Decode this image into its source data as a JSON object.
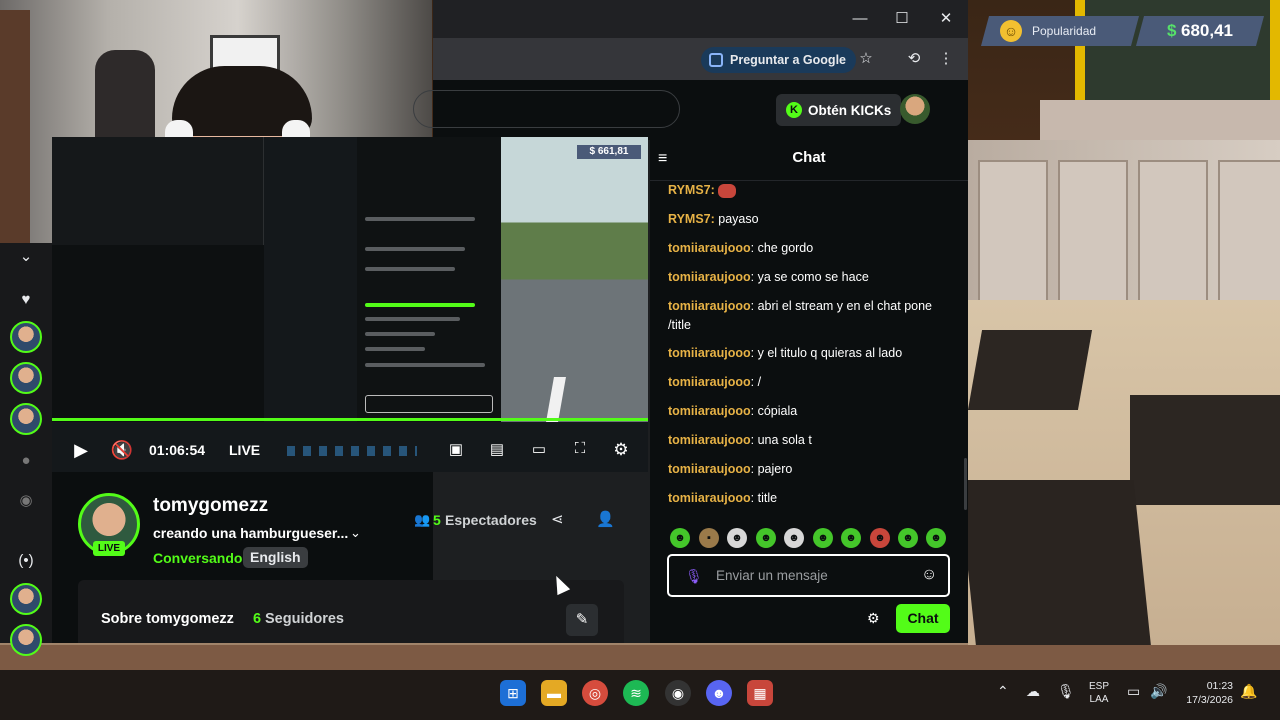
{
  "game_hud": {
    "popularity_label": "Popularidad",
    "money_currency": "$",
    "money_value": "680,41"
  },
  "browser": {
    "window_controls": [
      "—",
      "☐",
      "✕"
    ],
    "ask_google_label": "Preguntar a Google"
  },
  "kick_header": {
    "kicks_button_label": "Obtén KICKs"
  },
  "video": {
    "time": "01:06:54",
    "live_label": "LIVE",
    "nested_money": "$ 661,81"
  },
  "stream_info": {
    "streamer_name": "tomygomezz",
    "live_badge": "LIVE",
    "title": "creando una hamburgueser...",
    "category": "Conversando",
    "language": "English",
    "viewer_count": "5",
    "viewer_label": "Espectadores",
    "about_title": "Sobre tomygomezz",
    "followers_count": "6",
    "followers_label": "Seguidores"
  },
  "chat": {
    "title": "Chat",
    "messages": [
      {
        "user": "RYMS7",
        "text": ""
      },
      {
        "user": "RYMS7",
        "text": "payaso"
      },
      {
        "user": "tomiiaraujooo",
        "text": "che gordo"
      },
      {
        "user": "tomiiaraujooo",
        "text": "ya se como se hace"
      },
      {
        "user": "tomiiaraujooo",
        "text": "abri el stream y en el chat pone /title"
      },
      {
        "user": "tomiiaraujooo",
        "text": "y el titulo q quieras al lado"
      },
      {
        "user": "tomiiaraujooo",
        "text": "/"
      },
      {
        "user": "tomiiaraujooo",
        "text": "cópiala"
      },
      {
        "user": "tomiiaraujooo",
        "text": "una sola t"
      },
      {
        "user": "tomiiaraujooo",
        "text": "pajero"
      },
      {
        "user": "tomiiaraujooo",
        "text": "title"
      }
    ],
    "input_placeholder": "Enviar un mensaje",
    "send_label": "Chat"
  },
  "taskbar": {
    "lang_top": "ESP",
    "lang_bottom": "LAA",
    "time": "01:23",
    "date": "17/3/2026"
  },
  "colors": {
    "kick_green": "#53fc18",
    "username_gold": "#e7b246",
    "chat_bg": "#0b0e0f"
  }
}
